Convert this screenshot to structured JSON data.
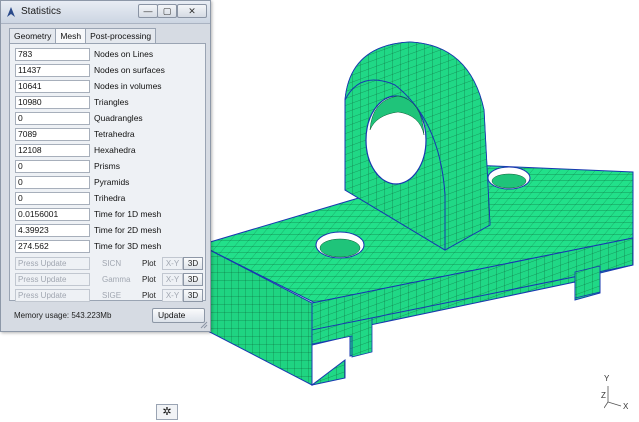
{
  "window": {
    "title": "Statistics",
    "min_label": "—",
    "max_label": "▢",
    "close_label": "✕"
  },
  "tabs": [
    {
      "label": "Geometry",
      "active": false
    },
    {
      "label": "Mesh",
      "active": true
    },
    {
      "label": "Post-processing",
      "active": false
    }
  ],
  "stats": [
    {
      "value": "783",
      "label": "Nodes on Lines"
    },
    {
      "value": "11437",
      "label": "Nodes on surfaces"
    },
    {
      "value": "10641",
      "label": "Nodes in volumes"
    },
    {
      "value": "10980",
      "label": "Triangles"
    },
    {
      "value": "0",
      "label": "Quadrangles"
    },
    {
      "value": "7089",
      "label": "Tetrahedra"
    },
    {
      "value": "12108",
      "label": "Hexahedra"
    },
    {
      "value": "0",
      "label": "Prisms"
    },
    {
      "value": "0",
      "label": "Pyramids"
    },
    {
      "value": "0",
      "label": "Trihedra"
    },
    {
      "value": "0.0156001",
      "label": "Time for 1D mesh"
    },
    {
      "value": "4.39923",
      "label": "Time for 2D mesh"
    },
    {
      "value": "274.562",
      "label": "Time for 3D mesh"
    }
  ],
  "quality_rows": [
    {
      "button": "Press Update",
      "measure": "SICN",
      "plot": "Plot",
      "xy": "X-Y",
      "three_d": "3D"
    },
    {
      "button": "Press Update",
      "measure": "Gamma",
      "plot": "Plot",
      "xy": "X-Y",
      "three_d": "3D"
    },
    {
      "button": "Press Update",
      "measure": "SIGE",
      "plot": "Plot",
      "xy": "X-Y",
      "three_d": "3D"
    }
  ],
  "memory_usage": "Memory usage: 543.223Mb",
  "update_label": "Update",
  "viewport": {
    "axis_y": "Y",
    "axis_z": "Z",
    "axis_x": "X",
    "gear_icon": "gear-icon"
  },
  "colors": {
    "mesh_fill": "#22e08a",
    "mesh_line": "#0b5a33",
    "edge_line": "#1838b0",
    "window_bg": "#d6dbe3"
  }
}
